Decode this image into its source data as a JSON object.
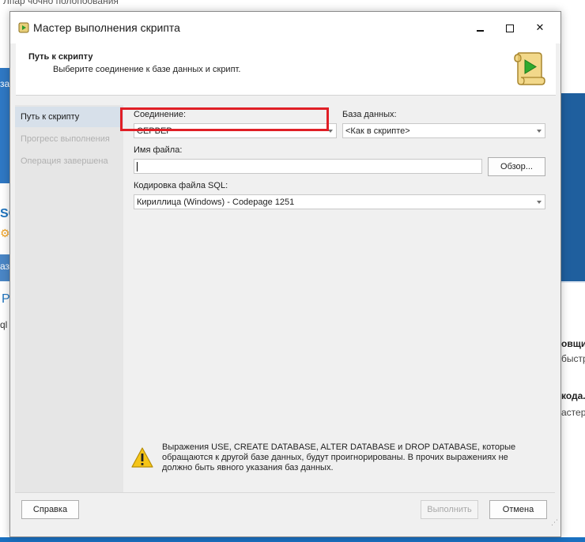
{
  "background": {
    "top_text": "Лпар чочно полопоования",
    "left_text1": "зая",
    "left_logo": "SC",
    "left_text2": "азр",
    "left_text3": "P",
    "left_text4": "ql",
    "right_t1": "овщи",
    "right_t2": "быстр",
    "right_t3": "кода.",
    "right_t4": "астер"
  },
  "dialog": {
    "title": "Мастер выполнения скрипта",
    "header_title": "Путь к скрипту",
    "header_subtitle": "Выберите соединение к базе данных и скрипт."
  },
  "nav": {
    "items": [
      {
        "label": "Путь к скрипту",
        "state": "active"
      },
      {
        "label": "Прогресс выполнения",
        "state": "disabled"
      },
      {
        "label": "Операция завершена",
        "state": "disabled"
      }
    ]
  },
  "form": {
    "connection_label": "Соединение:",
    "connection_value": "СЕРВЕР",
    "database_label": "База данных:",
    "database_value": "<Как в скрипте>",
    "filename_label": "Имя файла:",
    "filename_value": "",
    "browse_button": "Обзор...",
    "encoding_label": "Кодировка файла SQL:",
    "encoding_value": "Кириллица (Windows) - Codepage 1251"
  },
  "warning": {
    "text": "Выражения USE, CREATE DATABASE, ALTER DATABASE и DROP DATABASE, которые обращаются к другой базе данных, будут проигнорированы. В прочих выражениях не должно быть явного указания баз данных."
  },
  "footer": {
    "help_button": "Справка",
    "run_button": "Выполнить",
    "cancel_button": "Отмена"
  },
  "colors": {
    "highlight": "#e01f26",
    "nav_active": "#d7e0ea",
    "warning_yellow": "#f5c518"
  }
}
